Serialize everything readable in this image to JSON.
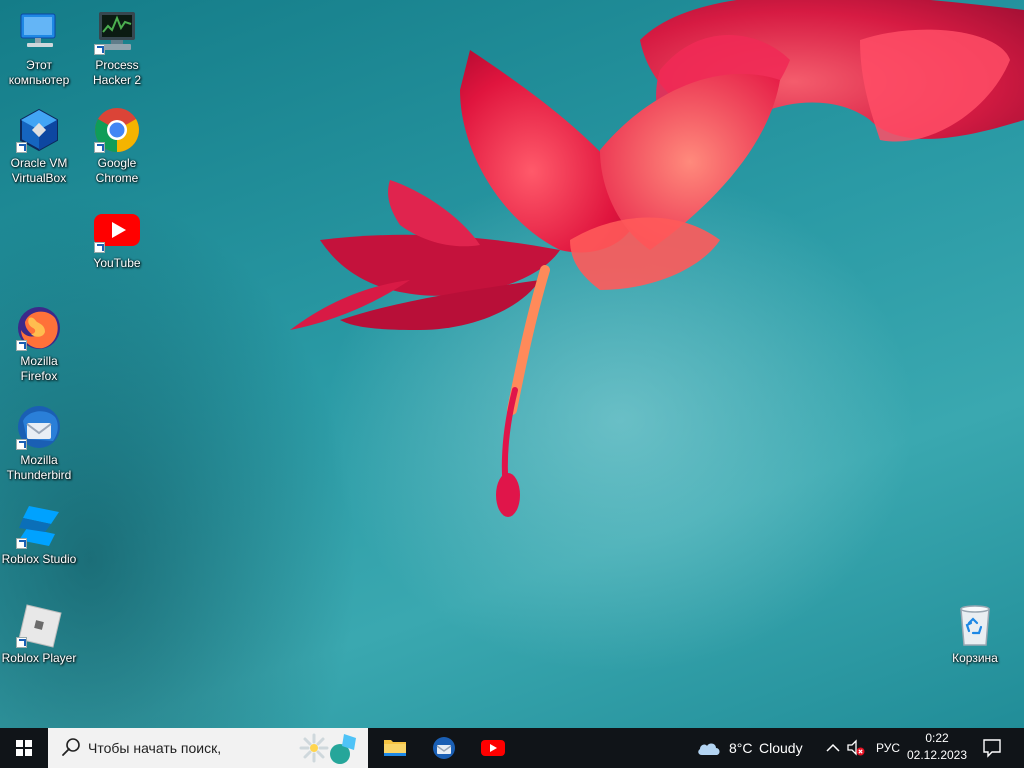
{
  "desktop": {
    "icons": [
      {
        "label": "Этот\nкомпьютер"
      },
      {
        "label": "Process\nHacker 2"
      },
      {
        "label": "Oracle VM\nVirtualBox"
      },
      {
        "label": "Google\nChrome"
      },
      {
        "label": "YouTube"
      },
      {
        "label": "Mozilla\nFirefox"
      },
      {
        "label": "Mozilla\nThunderbird"
      },
      {
        "label": "Roblox Studio"
      },
      {
        "label": "Roblox Player"
      },
      {
        "label": "Корзина"
      }
    ]
  },
  "taskbar": {
    "search_placeholder": "Чтобы начать поиск,",
    "weather": {
      "temp": "8°C",
      "condition": "Cloudy"
    },
    "language": "РУС",
    "time": "0:22",
    "date": "02.12.2023"
  },
  "colors": {
    "taskbar_bg": "#101418",
    "accent": "#0078d7"
  }
}
